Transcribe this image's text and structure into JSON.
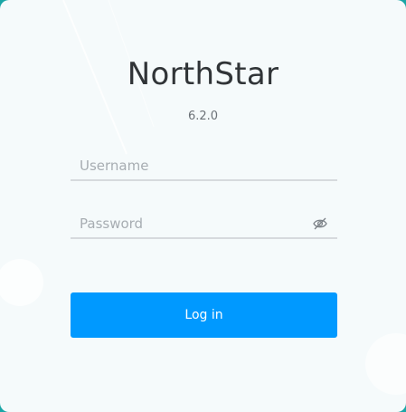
{
  "app": {
    "title": "NorthStar",
    "version": "6.2.0"
  },
  "form": {
    "username": {
      "value": "",
      "placeholder": "Username"
    },
    "password": {
      "value": "",
      "placeholder": "Password",
      "toggle_icon": "eye-slash-icon"
    },
    "login_label": "Log in"
  },
  "colors": {
    "background": "#1aa6a6",
    "card": "#f5fafb",
    "accent": "#0099ff",
    "title": "#303437"
  }
}
